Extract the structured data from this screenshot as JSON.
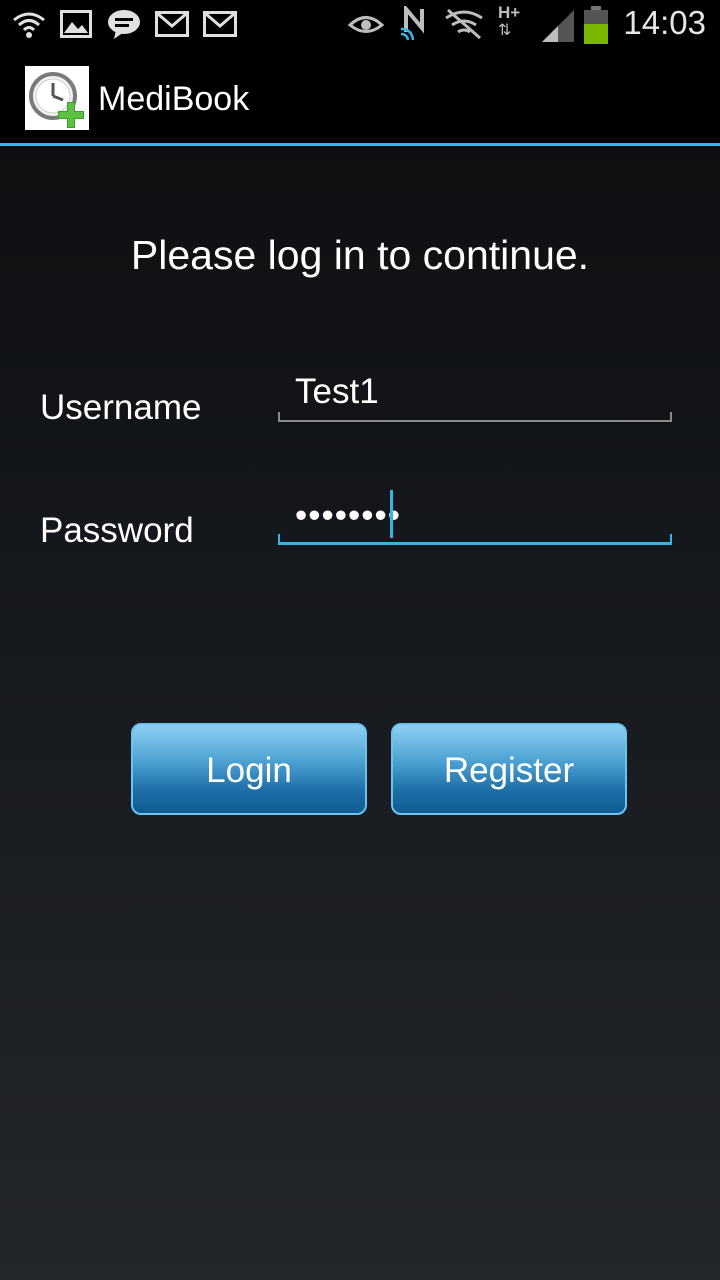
{
  "status_bar": {
    "time": "14:03",
    "icons": [
      "wifi-icon",
      "image-icon",
      "chat-icon",
      "gmail-icon",
      "gmail-icon",
      "eye-icon",
      "nfc-icon",
      "no-signal-icon",
      "hplus-data-icon",
      "signal-icon",
      "battery-icon"
    ]
  },
  "action_bar": {
    "title": "MediBook",
    "icon": "clock-plus-icon",
    "accent_color": "#33b5e5"
  },
  "main": {
    "prompt": "Please log in to continue.",
    "username_label": "Username",
    "username_value": "Test1",
    "password_label": "Password",
    "password_value": "••••••••",
    "login_label": "Login",
    "register_label": "Register"
  }
}
